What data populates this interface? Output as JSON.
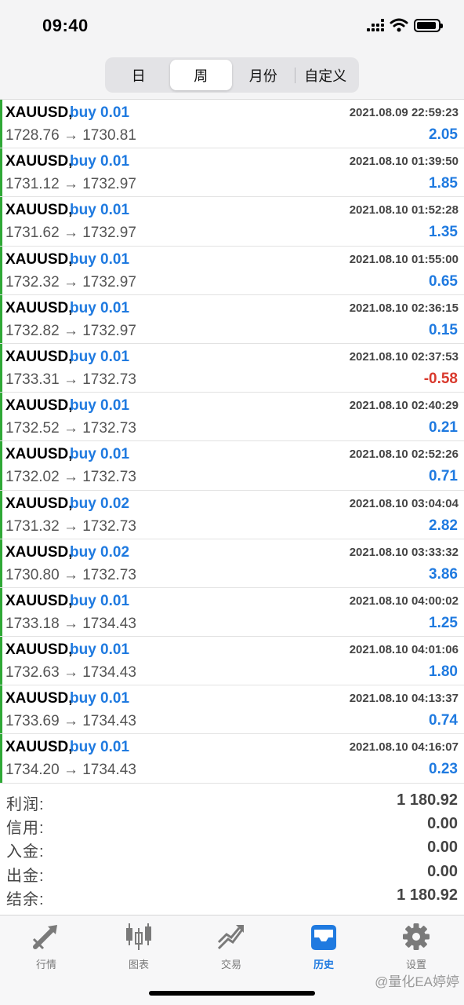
{
  "status_bar": {
    "time": "09:40"
  },
  "segment": {
    "tabs": [
      "日",
      "周",
      "月份",
      "自定义"
    ],
    "active_index": 1
  },
  "deals": [
    {
      "symbol": "XAUUSD,",
      "direction": "buy 0.01",
      "datetime": "2021.08.09 22:59:23",
      "prices": "1728.76 → 1730.81",
      "profit": "2.05"
    },
    {
      "symbol": "XAUUSD,",
      "direction": "buy 0.01",
      "datetime": "2021.08.10 01:39:50",
      "prices": "1731.12 → 1732.97",
      "profit": "1.85"
    },
    {
      "symbol": "XAUUSD,",
      "direction": "buy 0.01",
      "datetime": "2021.08.10 01:52:28",
      "prices": "1731.62 → 1732.97",
      "profit": "1.35"
    },
    {
      "symbol": "XAUUSD,",
      "direction": "buy 0.01",
      "datetime": "2021.08.10 01:55:00",
      "prices": "1732.32 → 1732.97",
      "profit": "0.65"
    },
    {
      "symbol": "XAUUSD,",
      "direction": "buy 0.01",
      "datetime": "2021.08.10 02:36:15",
      "prices": "1732.82 → 1732.97",
      "profit": "0.15"
    },
    {
      "symbol": "XAUUSD,",
      "direction": "buy 0.01",
      "datetime": "2021.08.10 02:37:53",
      "prices": "1733.31 → 1732.73",
      "profit": "-0.58"
    },
    {
      "symbol": "XAUUSD,",
      "direction": "buy 0.01",
      "datetime": "2021.08.10 02:40:29",
      "prices": "1732.52 → 1732.73",
      "profit": "0.21"
    },
    {
      "symbol": "XAUUSD,",
      "direction": "buy 0.01",
      "datetime": "2021.08.10 02:52:26",
      "prices": "1732.02 → 1732.73",
      "profit": "0.71"
    },
    {
      "symbol": "XAUUSD,",
      "direction": "buy 0.02",
      "datetime": "2021.08.10 03:04:04",
      "prices": "1731.32 → 1732.73",
      "profit": "2.82"
    },
    {
      "symbol": "XAUUSD,",
      "direction": "buy 0.02",
      "datetime": "2021.08.10 03:33:32",
      "prices": "1730.80 → 1732.73",
      "profit": "3.86"
    },
    {
      "symbol": "XAUUSD,",
      "direction": "buy 0.01",
      "datetime": "2021.08.10 04:00:02",
      "prices": "1733.18 → 1734.43",
      "profit": "1.25"
    },
    {
      "symbol": "XAUUSD,",
      "direction": "buy 0.01",
      "datetime": "2021.08.10 04:01:06",
      "prices": "1732.63 → 1734.43",
      "profit": "1.80"
    },
    {
      "symbol": "XAUUSD,",
      "direction": "buy 0.01",
      "datetime": "2021.08.10 04:13:37",
      "prices": "1733.69 → 1734.43",
      "profit": "0.74"
    },
    {
      "symbol": "XAUUSD,",
      "direction": "buy 0.01",
      "datetime": "2021.08.10 04:16:07",
      "prices": "1734.20 → 1734.43",
      "profit": "0.23"
    }
  ],
  "summary": [
    {
      "label": "利润:",
      "value": "1 180.92"
    },
    {
      "label": "信用:",
      "value": "0.00"
    },
    {
      "label": "入金:",
      "value": "0.00"
    },
    {
      "label": "出金:",
      "value": "0.00"
    },
    {
      "label": "结余:",
      "value": "1 180.92"
    }
  ],
  "tabbar": {
    "tabs": [
      {
        "label": "行情",
        "icon": "quotes-arrows-icon"
      },
      {
        "label": "图表",
        "icon": "candlestick-chart-icon"
      },
      {
        "label": "交易",
        "icon": "trade-trend-icon"
      },
      {
        "label": "历史",
        "icon": "history-inbox-icon"
      },
      {
        "label": "设置",
        "icon": "gear-icon"
      }
    ],
    "active_index": 3
  },
  "watermark": "@量化EA婷婷",
  "colors": {
    "accent": "#1f7ae0",
    "negative": "#d93a2e",
    "buy_bar": "#2fa836"
  }
}
